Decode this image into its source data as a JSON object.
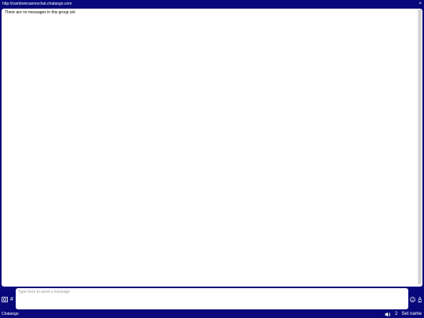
{
  "window": {
    "url": "http://cambonicasmochat.chatango.com",
    "close_glyph": "×"
  },
  "messages": {
    "empty_text": "There are no messages in this group yet."
  },
  "composer": {
    "placeholder": "Type here to send a message",
    "hash_label": "#",
    "font_label": "A"
  },
  "footer": {
    "brand": "Chatango",
    "user_count": "2",
    "set_name_label": "Set name"
  },
  "colors": {
    "background": "#08087a",
    "panel": "#ffffff"
  },
  "icons": [
    "image-icon",
    "hash-icon",
    "smiley-icon",
    "font-icon",
    "speaker-icon",
    "close-icon"
  ]
}
